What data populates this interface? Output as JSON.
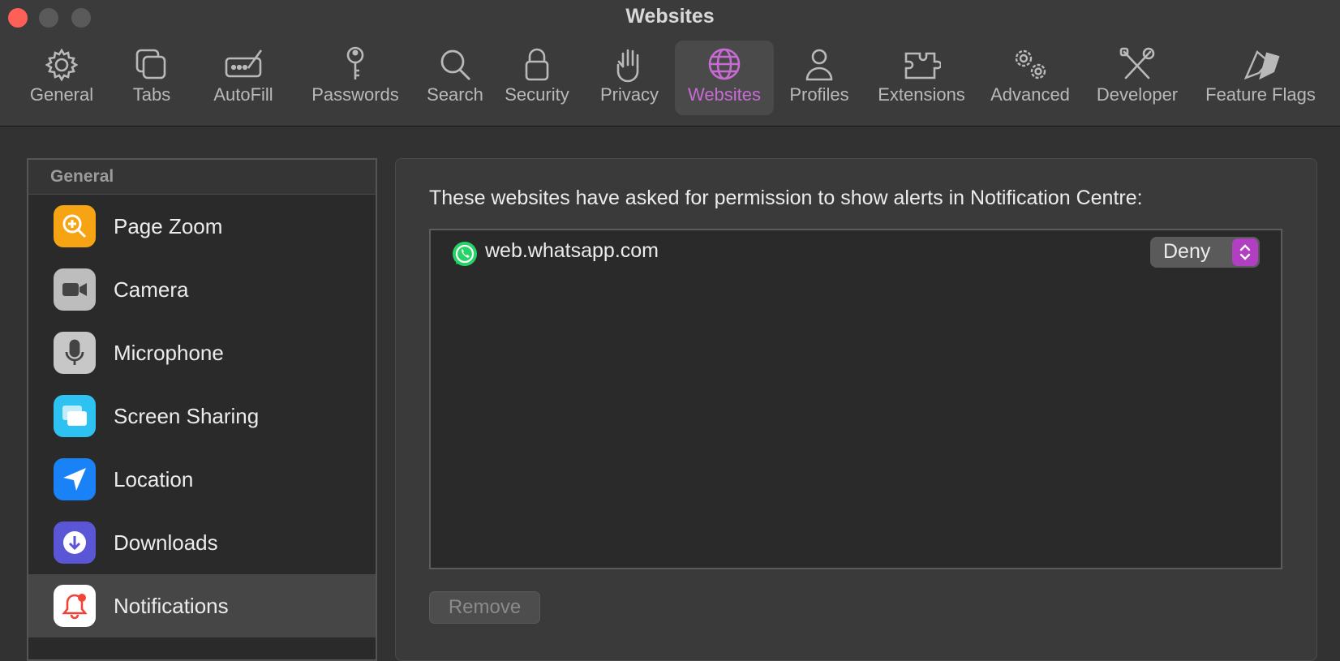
{
  "window": {
    "title": "Websites"
  },
  "toolbar": {
    "items": [
      {
        "label": "General",
        "icon": "gear-icon"
      },
      {
        "label": "Tabs",
        "icon": "tabs-icon"
      },
      {
        "label": "AutoFill",
        "icon": "autofill-icon"
      },
      {
        "label": "Passwords",
        "icon": "key-icon"
      },
      {
        "label": "Search",
        "icon": "search-icon"
      },
      {
        "label": "Security",
        "icon": "lock-icon"
      },
      {
        "label": "Privacy",
        "icon": "hand-icon"
      },
      {
        "label": "Websites",
        "icon": "globe-icon",
        "selected": true
      },
      {
        "label": "Profiles",
        "icon": "person-icon"
      },
      {
        "label": "Extensions",
        "icon": "puzzle-icon"
      },
      {
        "label": "Advanced",
        "icon": "gears-icon"
      },
      {
        "label": "Developer",
        "icon": "tools-icon"
      },
      {
        "label": "Feature Flags",
        "icon": "flags-icon"
      }
    ],
    "accent_color": "#c86bd4"
  },
  "sidebar": {
    "section_title": "General",
    "items": [
      {
        "label": "Page Zoom",
        "icon": "page-zoom-icon"
      },
      {
        "label": "Camera",
        "icon": "camera-icon"
      },
      {
        "label": "Microphone",
        "icon": "microphone-icon"
      },
      {
        "label": "Screen Sharing",
        "icon": "screen-sharing-icon"
      },
      {
        "label": "Location",
        "icon": "location-icon"
      },
      {
        "label": "Downloads",
        "icon": "downloads-icon"
      },
      {
        "label": "Notifications",
        "icon": "notifications-icon",
        "selected": true
      }
    ]
  },
  "main": {
    "description": "These websites have asked for permission to show alerts in Notification Centre:",
    "websites": [
      {
        "name": "web.whatsapp.com",
        "icon": "whatsapp-icon",
        "permission": "Deny"
      }
    ],
    "remove_label": "Remove"
  }
}
